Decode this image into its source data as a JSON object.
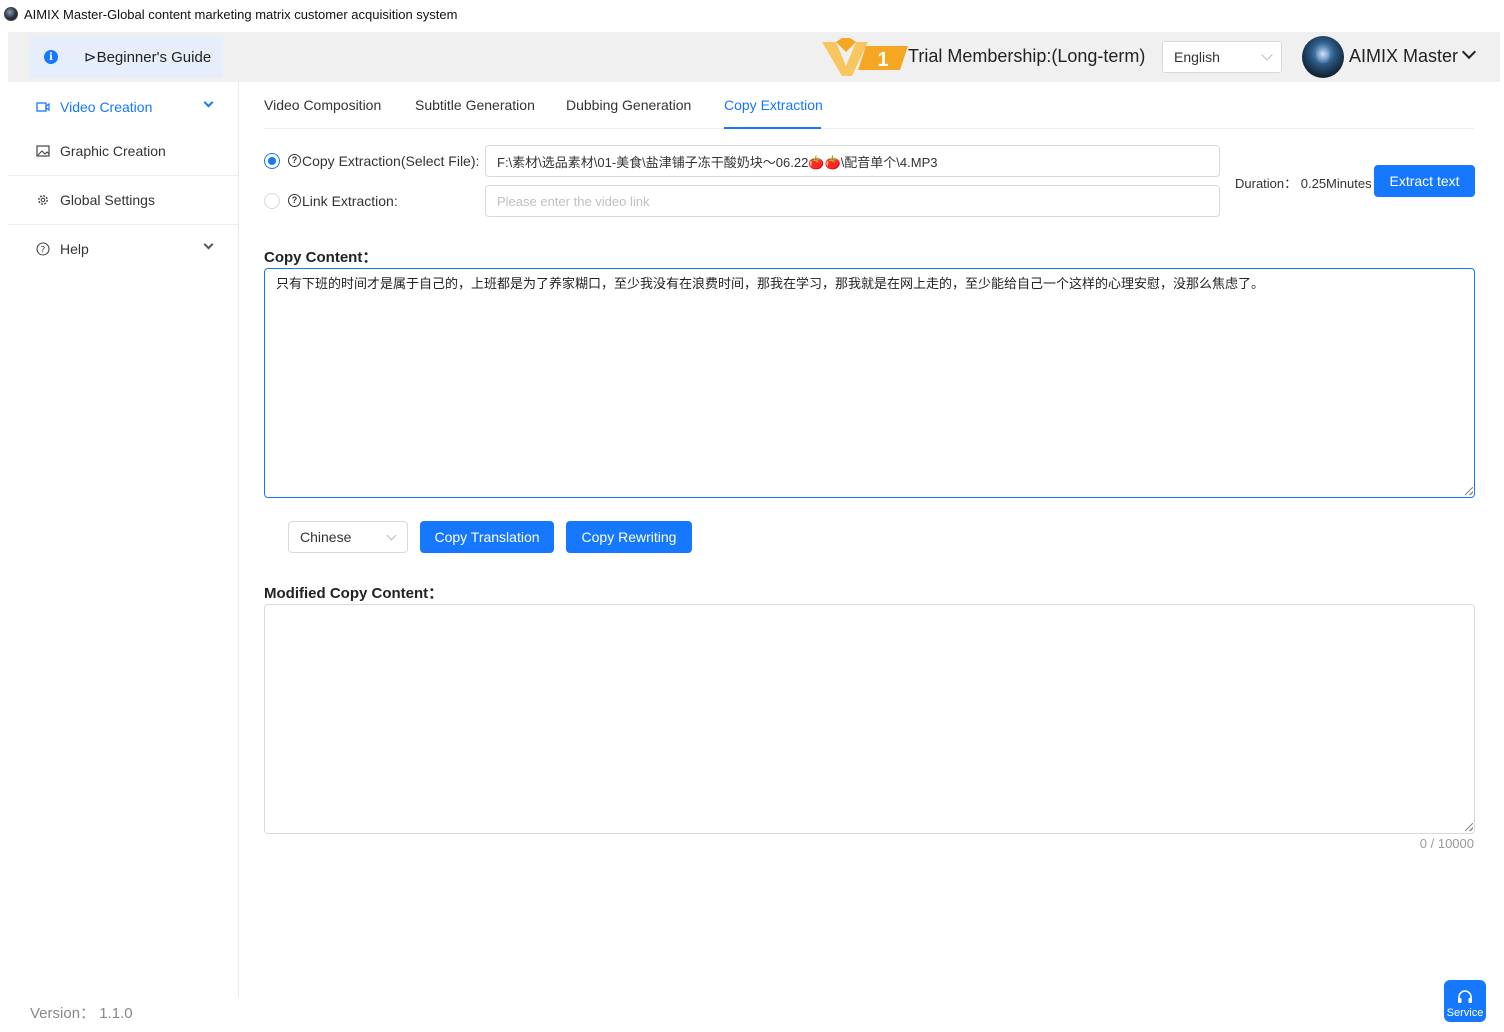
{
  "window": {
    "title": "AIMIX Master-Global content marketing matrix customer acquisition system"
  },
  "header": {
    "guide_label": "⊳Beginner's Guide",
    "membership_label": "Trial Membership:(Long-term)",
    "vip_level": "1",
    "language": "English",
    "user_name": "AIMIX Master"
  },
  "sidebar": {
    "items": [
      {
        "label": "Video Creation",
        "icon": "video-icon",
        "active": true,
        "expandable": true
      },
      {
        "label": "Graphic Creation",
        "icon": "image-icon",
        "active": false,
        "expandable": false
      },
      {
        "label": "Global Settings",
        "icon": "gear-icon",
        "active": false,
        "expandable": false
      },
      {
        "label": "Help",
        "icon": "help-icon",
        "active": false,
        "expandable": true
      }
    ],
    "version": "Version： 1.1.0"
  },
  "tabs": [
    {
      "label": "Video Composition",
      "active": false
    },
    {
      "label": "Subtitle Generation",
      "active": false
    },
    {
      "label": "Dubbing Generation",
      "active": false
    },
    {
      "label": "Copy Extraction",
      "active": true
    }
  ],
  "extraction": {
    "file_option": {
      "label": "Copy Extraction(Select File):",
      "selected": true,
      "value": "F:\\素材\\选品素材\\01-美食\\盐津铺子冻干酸奶块～06.22🍅🍅\\配音单个\\4.MP3"
    },
    "link_option": {
      "label": "Link Extraction:",
      "selected": false,
      "placeholder": "Please enter the video link",
      "value": ""
    },
    "duration": "Duration： 0.25Minutes",
    "extract_button": "Extract text"
  },
  "copy_content": {
    "title": "Copy Content：",
    "text": "只有下班的时间才是属于自己的，上班都是为了养家糊口，至少我没有在浪费时间，那我在学习，那我就是在网上走的，至少能给自己一个这样的心理安慰，没那么焦虑了。"
  },
  "actions": {
    "target_language": "Chinese",
    "translate_button": "Copy Translation",
    "rewrite_button": "Copy Rewriting"
  },
  "modified_content": {
    "title": "Modified Copy Content：",
    "text": "",
    "counter": "0 / 10000"
  },
  "service": {
    "label": "Service"
  },
  "colors": {
    "accent": "#1677ff",
    "vip_orange": "#f5a623"
  }
}
